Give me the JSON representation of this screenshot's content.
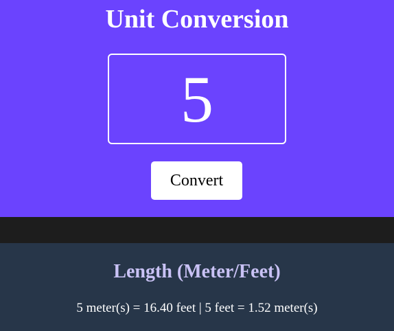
{
  "header": {
    "title": "Unit Conversion",
    "input_value": "5",
    "convert_label": "Convert"
  },
  "results": [
    {
      "title": "Length (Meter/Feet)",
      "text": "5 meter(s) = 16.40 feet | 5 feet = 1.52 meter(s)"
    }
  ],
  "colors": {
    "header_bg": "#6b43fe",
    "band_bg": "#1d1d1d",
    "card_bg": "#273649",
    "card_title": "#c9c2f5"
  }
}
